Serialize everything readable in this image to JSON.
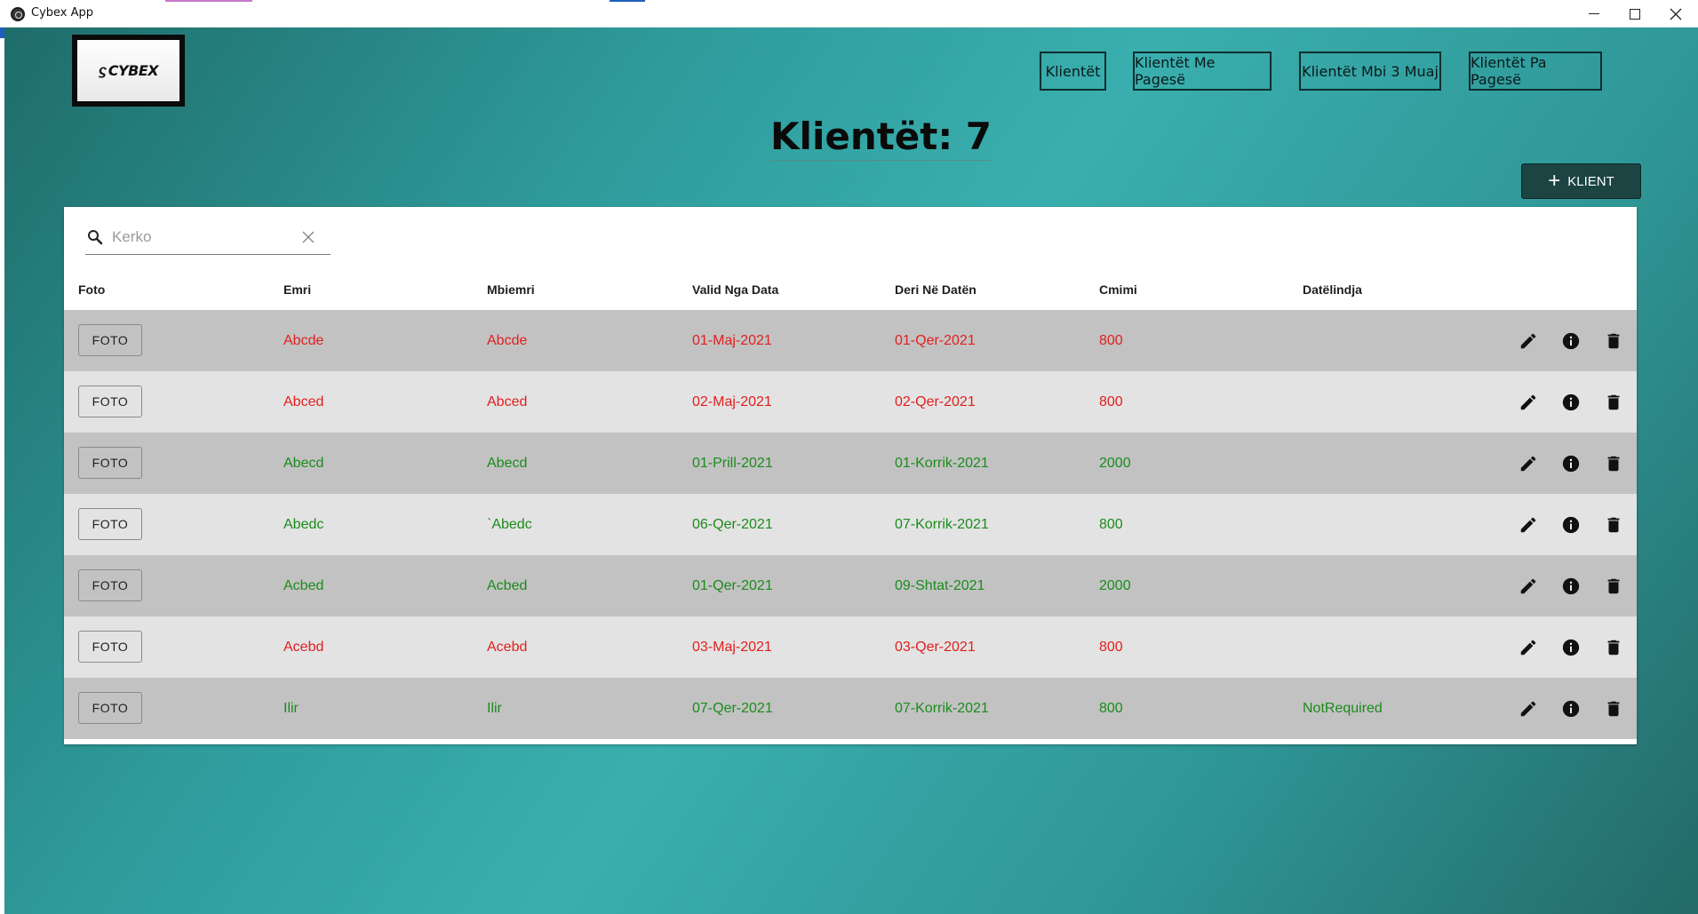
{
  "window": {
    "title": "Cybex App"
  },
  "logo": {
    "text": "CYBEX"
  },
  "nav": [
    {
      "label": "Klientët"
    },
    {
      "label": "Klientët Me Pagesë"
    },
    {
      "label": "Klientët Mbi 3 Muaj"
    },
    {
      "label": "Klientët Pa Pagesë"
    }
  ],
  "page_title": "Klientët: 7",
  "add_button": {
    "icon": "plus-icon",
    "label": "KLIENT"
  },
  "search": {
    "placeholder": "Kerko",
    "value": ""
  },
  "table": {
    "columns": [
      "Foto",
      "Emri",
      "Mbiemri",
      "Valid Nga Data",
      "Deri Në Datën",
      "Cmimi",
      "Datëlindja"
    ],
    "foto_label": "FOTO",
    "rows": [
      {
        "emri": "Abcde",
        "mbiemri": "Abcde",
        "valid": "01-Maj-2021",
        "deri": "01-Qer-2021",
        "cmimi": "800",
        "datelindja": "",
        "status": "expired"
      },
      {
        "emri": "Abced",
        "mbiemri": "Abced",
        "valid": "02-Maj-2021",
        "deri": "02-Qer-2021",
        "cmimi": "800",
        "datelindja": "",
        "status": "expired"
      },
      {
        "emri": "Abecd",
        "mbiemri": "Abecd",
        "valid": "01-Prill-2021",
        "deri": "01-Korrik-2021",
        "cmimi": "2000",
        "datelindja": "",
        "status": "active"
      },
      {
        "emri": "Abedc",
        "mbiemri": "`Abedc",
        "valid": "06-Qer-2021",
        "deri": "07-Korrik-2021",
        "cmimi": "800",
        "datelindja": "",
        "status": "active"
      },
      {
        "emri": "Acbed",
        "mbiemri": "Acbed",
        "valid": "01-Qer-2021",
        "deri": "09-Shtat-2021",
        "cmimi": "2000",
        "datelindja": "",
        "status": "active"
      },
      {
        "emri": "Acebd",
        "mbiemri": "Acebd",
        "valid": "03-Maj-2021",
        "deri": "03-Qer-2021",
        "cmimi": "800",
        "datelindja": "",
        "status": "expired"
      },
      {
        "emri": "Ilir",
        "mbiemri": "Ilir",
        "valid": "07-Qer-2021",
        "deri": "07-Korrik-2021",
        "cmimi": "800",
        "datelindja": "NotRequired",
        "status": "active"
      }
    ],
    "row_actions": [
      "edit-icon",
      "info-icon",
      "delete-icon"
    ]
  },
  "colors": {
    "expired": "#e11f1f",
    "active": "#1b8b1b",
    "row_odd": "#c2c2c2",
    "row_even": "#e3e3e3",
    "add_button_bg": "#1b4443"
  }
}
